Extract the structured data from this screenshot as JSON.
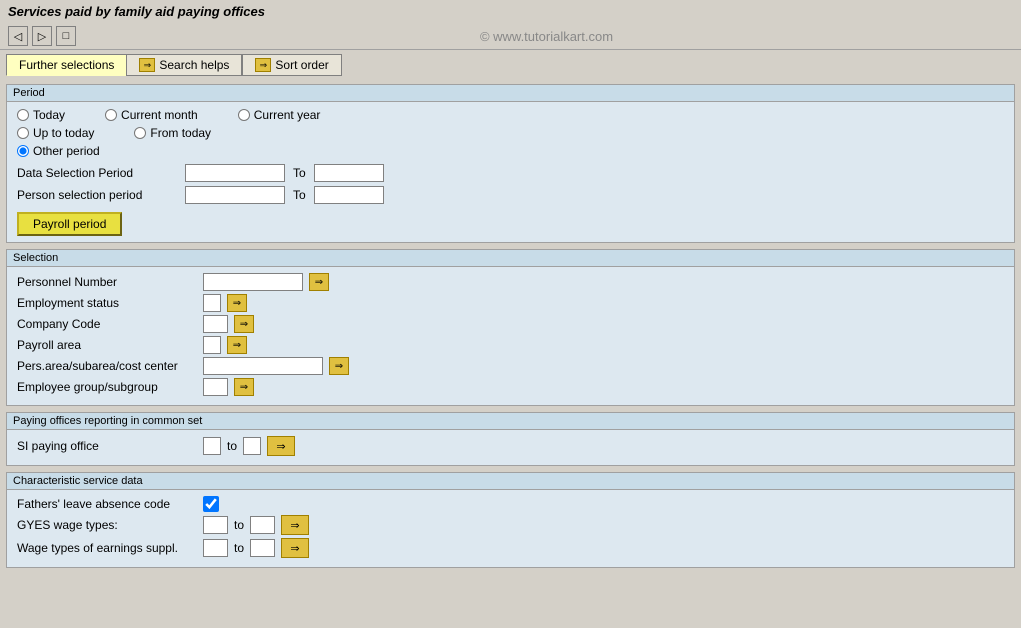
{
  "title": "Services paid by family aid paying offices",
  "watermark": "© www.tutorialkart.com",
  "toolbar": {
    "icons": [
      "back-icon",
      "forward-icon",
      "save-icon"
    ]
  },
  "tabs": [
    {
      "label": "Further selections",
      "active": true
    },
    {
      "label": "Search helps",
      "active": false
    },
    {
      "label": "Sort order",
      "active": false
    }
  ],
  "period_section": {
    "title": "Period",
    "options": [
      {
        "label": "Today",
        "name": "today"
      },
      {
        "label": "Current month",
        "name": "current_month"
      },
      {
        "label": "Current year",
        "name": "current_year"
      },
      {
        "label": "Up to today",
        "name": "up_to_today"
      },
      {
        "label": "From today",
        "name": "from_today"
      },
      {
        "label": "Other period",
        "name": "other_period",
        "checked": true
      }
    ],
    "data_selection_label": "Data Selection Period",
    "person_selection_label": "Person selection period",
    "to_label": "To",
    "payroll_btn": "Payroll period"
  },
  "selection_section": {
    "title": "Selection",
    "fields": [
      {
        "label": "Personnel Number",
        "size": "md"
      },
      {
        "label": "Employment status",
        "size": "xxs"
      },
      {
        "label": "Company Code",
        "size": "xs"
      },
      {
        "label": "Payroll area",
        "size": "xxs"
      },
      {
        "label": "Pers.area/subarea/cost center",
        "size": "lg"
      },
      {
        "label": "Employee group/subgroup",
        "size": "xs"
      }
    ]
  },
  "paying_offices_section": {
    "title": "Paying offices reporting in common set",
    "si_label": "SI paying office",
    "to_label": "to"
  },
  "characteristic_section": {
    "title": "Characteristic service data",
    "fields": [
      {
        "label": "Fathers' leave absence code",
        "type": "checkbox"
      },
      {
        "label": "GYES wage types:",
        "type": "range",
        "to_label": "to"
      },
      {
        "label": "Wage types of earnings suppl.",
        "type": "range",
        "to_label": "to"
      }
    ]
  }
}
